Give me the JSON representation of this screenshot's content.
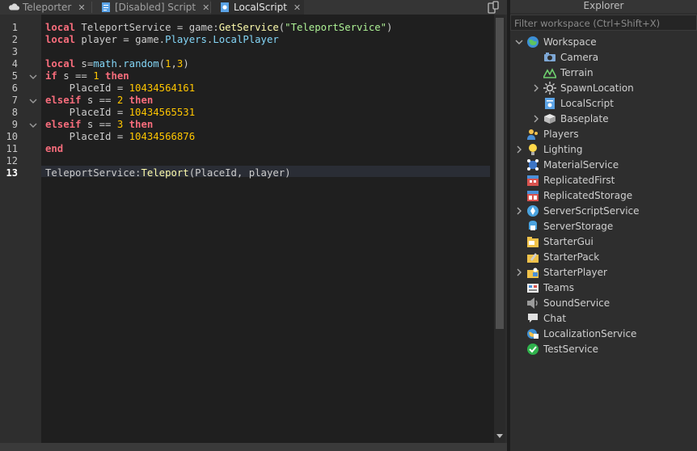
{
  "tabs": [
    {
      "label": "Teleporter",
      "active": false,
      "icon": "cloud-icon"
    },
    {
      "label": "[Disabled] Script",
      "active": false,
      "icon": "script-icon"
    },
    {
      "label": "LocalScript",
      "active": true,
      "icon": "localscript-icon"
    }
  ],
  "editor": {
    "current_line": 13,
    "line_numbers": [
      "1",
      "2",
      "3",
      "4",
      "5",
      "6",
      "7",
      "8",
      "9",
      "10",
      "11",
      "12",
      "13"
    ],
    "lines": [
      [
        {
          "t": "local",
          "c": "kw"
        },
        {
          "t": " TeleportService = game:",
          "c": "plain"
        },
        {
          "t": "GetService",
          "c": "fn"
        },
        {
          "t": "(",
          "c": "plain"
        },
        {
          "t": "\"TeleportService\"",
          "c": "str"
        },
        {
          "t": ")",
          "c": "plain"
        }
      ],
      [
        {
          "t": "local",
          "c": "kw"
        },
        {
          "t": " player = game.",
          "c": "plain"
        },
        {
          "t": "Players",
          "c": "bi"
        },
        {
          "t": ".",
          "c": "plain"
        },
        {
          "t": "LocalPlayer",
          "c": "bi"
        }
      ],
      [],
      [
        {
          "t": "local",
          "c": "kw"
        },
        {
          "t": " s=",
          "c": "plain"
        },
        {
          "t": "math",
          "c": "bi"
        },
        {
          "t": ".",
          "c": "plain"
        },
        {
          "t": "random",
          "c": "bi"
        },
        {
          "t": "(",
          "c": "plain"
        },
        {
          "t": "1",
          "c": "num"
        },
        {
          "t": ",",
          "c": "plain"
        },
        {
          "t": "3",
          "c": "num"
        },
        {
          "t": ")",
          "c": "plain"
        }
      ],
      [
        {
          "t": "if",
          "c": "kw"
        },
        {
          "t": " s == ",
          "c": "plain"
        },
        {
          "t": "1",
          "c": "num"
        },
        {
          "t": " ",
          "c": "plain"
        },
        {
          "t": "then",
          "c": "kw"
        }
      ],
      [
        {
          "t": "    PlaceId = ",
          "c": "plain"
        },
        {
          "t": "10434564161",
          "c": "num"
        }
      ],
      [
        {
          "t": "elseif",
          "c": "kw"
        },
        {
          "t": " s == ",
          "c": "plain"
        },
        {
          "t": "2",
          "c": "num"
        },
        {
          "t": " ",
          "c": "plain"
        },
        {
          "t": "then",
          "c": "kw"
        }
      ],
      [
        {
          "t": "    PlaceId = ",
          "c": "plain"
        },
        {
          "t": "10434565531",
          "c": "num"
        }
      ],
      [
        {
          "t": "elseif",
          "c": "kw"
        },
        {
          "t": " s == ",
          "c": "plain"
        },
        {
          "t": "3",
          "c": "num"
        },
        {
          "t": " ",
          "c": "plain"
        },
        {
          "t": "then",
          "c": "kw"
        }
      ],
      [
        {
          "t": "    PlaceId = ",
          "c": "plain"
        },
        {
          "t": "10434566876",
          "c": "num"
        }
      ],
      [
        {
          "t": "end",
          "c": "kw"
        }
      ],
      [],
      [
        {
          "t": "TeleportService:",
          "c": "plain"
        },
        {
          "t": "Teleport",
          "c": "fn"
        },
        {
          "t": "(PlaceId, player)",
          "c": "plain"
        }
      ]
    ],
    "fold_lines": [
      5,
      7,
      9
    ]
  },
  "explorer": {
    "title": "Explorer",
    "filter_placeholder": "Filter workspace (Ctrl+Shift+X)",
    "items": [
      {
        "label": "Workspace",
        "depth": 0,
        "arrow": "expanded",
        "icon": "workspace-icon"
      },
      {
        "label": "Camera",
        "depth": 1,
        "arrow": "none",
        "icon": "camera-icon"
      },
      {
        "label": "Terrain",
        "depth": 1,
        "arrow": "none",
        "icon": "terrain-icon"
      },
      {
        "label": "SpawnLocation",
        "depth": 1,
        "arrow": "collapsed",
        "icon": "spawnlocation-icon"
      },
      {
        "label": "LocalScript",
        "depth": 1,
        "arrow": "none",
        "icon": "localscript-icon"
      },
      {
        "label": "Baseplate",
        "depth": 1,
        "arrow": "collapsed",
        "icon": "baseplate-icon"
      },
      {
        "label": "Players",
        "depth": 0,
        "arrow": "none",
        "icon": "players-icon"
      },
      {
        "label": "Lighting",
        "depth": 0,
        "arrow": "collapsed",
        "icon": "lighting-icon"
      },
      {
        "label": "MaterialService",
        "depth": 0,
        "arrow": "none",
        "icon": "materialservice-icon"
      },
      {
        "label": "ReplicatedFirst",
        "depth": 0,
        "arrow": "none",
        "icon": "replicatedfirst-icon"
      },
      {
        "label": "ReplicatedStorage",
        "depth": 0,
        "arrow": "none",
        "icon": "replicatedstorage-icon"
      },
      {
        "label": "ServerScriptService",
        "depth": 0,
        "arrow": "collapsed",
        "icon": "serverscriptservice-icon"
      },
      {
        "label": "ServerStorage",
        "depth": 0,
        "arrow": "none",
        "icon": "serverstorage-icon"
      },
      {
        "label": "StarterGui",
        "depth": 0,
        "arrow": "none",
        "icon": "startergui-icon"
      },
      {
        "label": "StarterPack",
        "depth": 0,
        "arrow": "none",
        "icon": "starterpack-icon"
      },
      {
        "label": "StarterPlayer",
        "depth": 0,
        "arrow": "collapsed",
        "icon": "starterplayer-icon"
      },
      {
        "label": "Teams",
        "depth": 0,
        "arrow": "none",
        "icon": "teams-icon"
      },
      {
        "label": "SoundService",
        "depth": 0,
        "arrow": "none",
        "icon": "soundservice-icon"
      },
      {
        "label": "Chat",
        "depth": 0,
        "arrow": "none",
        "icon": "chat-icon"
      },
      {
        "label": "LocalizationService",
        "depth": 0,
        "arrow": "none",
        "icon": "localizationservice-icon"
      },
      {
        "label": "TestService",
        "depth": 0,
        "arrow": "none",
        "icon": "testservice-icon"
      }
    ]
  },
  "colors": {
    "keyword": "#f86d7c",
    "number": "#ffc600",
    "string": "#adf195",
    "function": "#fdfbac",
    "builtin": "#84d6f7",
    "editor_bg": "#1f1f1f",
    "panel_bg": "#2e2e2e"
  }
}
